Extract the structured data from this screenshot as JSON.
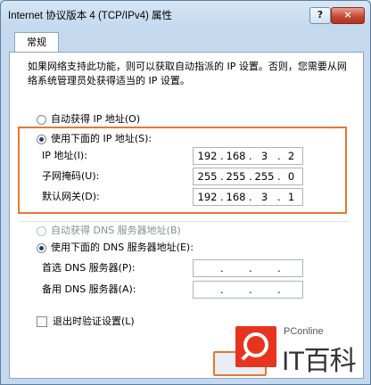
{
  "window": {
    "title": "Internet 协议版本 4 (TCP/IPv4) 属性",
    "help_label": "?",
    "close_label": "×"
  },
  "tabs": [
    {
      "label": "常规"
    }
  ],
  "description": "如果网络支持此功能，则可以获取自动指派的 IP 设置。否则，您需要从网络系统管理员处获得适当的 IP 设置。",
  "ip_section": {
    "auto_label": "自动获得 IP 地址(O)",
    "manual_label": "使用下面的 IP 地址(S):",
    "fields": [
      {
        "label": "IP 地址(I):",
        "octets": [
          "192",
          "168",
          "3",
          "2"
        ]
      },
      {
        "label": "子网掩码(U):",
        "octets": [
          "255",
          "255",
          "255",
          "0"
        ]
      },
      {
        "label": "默认网关(D):",
        "octets": [
          "192",
          "168",
          "3",
          "1"
        ]
      }
    ]
  },
  "dns_section": {
    "auto_label": "自动获得 DNS 服务器地址(B)",
    "manual_label": "使用下面的 DNS 服务器地址(E):",
    "fields": [
      {
        "label": "首选 DNS 服务器(P):",
        "octets": [
          "",
          "",
          "",
          ""
        ]
      },
      {
        "label": "备用 DNS 服务器(A):",
        "octets": [
          "",
          "",
          "",
          ""
        ]
      }
    ]
  },
  "validate_label": "退出时验证设置(L)",
  "watermark": {
    "small": "PConline",
    "big": "IT百科"
  }
}
